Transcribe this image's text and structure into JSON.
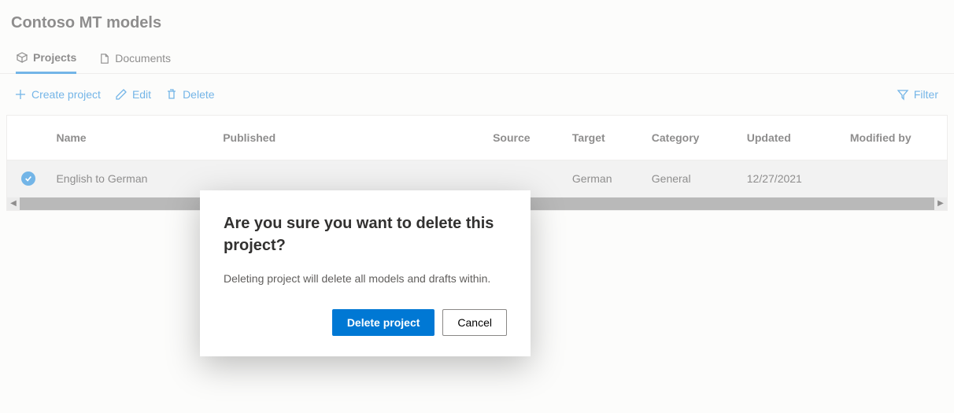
{
  "title": "Contoso MT models",
  "tabs": [
    {
      "label": "Projects",
      "active": true
    },
    {
      "label": "Documents",
      "active": false
    }
  ],
  "toolbar": {
    "create": "Create project",
    "edit": "Edit",
    "delete": "Delete",
    "filter": "Filter"
  },
  "columns": {
    "name": "Name",
    "published": "Published",
    "source": "Source",
    "target": "Target",
    "category": "Category",
    "updated": "Updated",
    "modifiedby": "Modified by"
  },
  "rows": [
    {
      "selected": true,
      "name": "English to German",
      "published": "",
      "source": "",
      "target": "German",
      "category": "General",
      "updated": "12/27/2021",
      "modifiedby": ""
    }
  ],
  "dialog": {
    "title": "Are you sure you want to delete this project?",
    "body": "Deleting project will delete all models and drafts within.",
    "confirm": "Delete project",
    "cancel": "Cancel"
  }
}
